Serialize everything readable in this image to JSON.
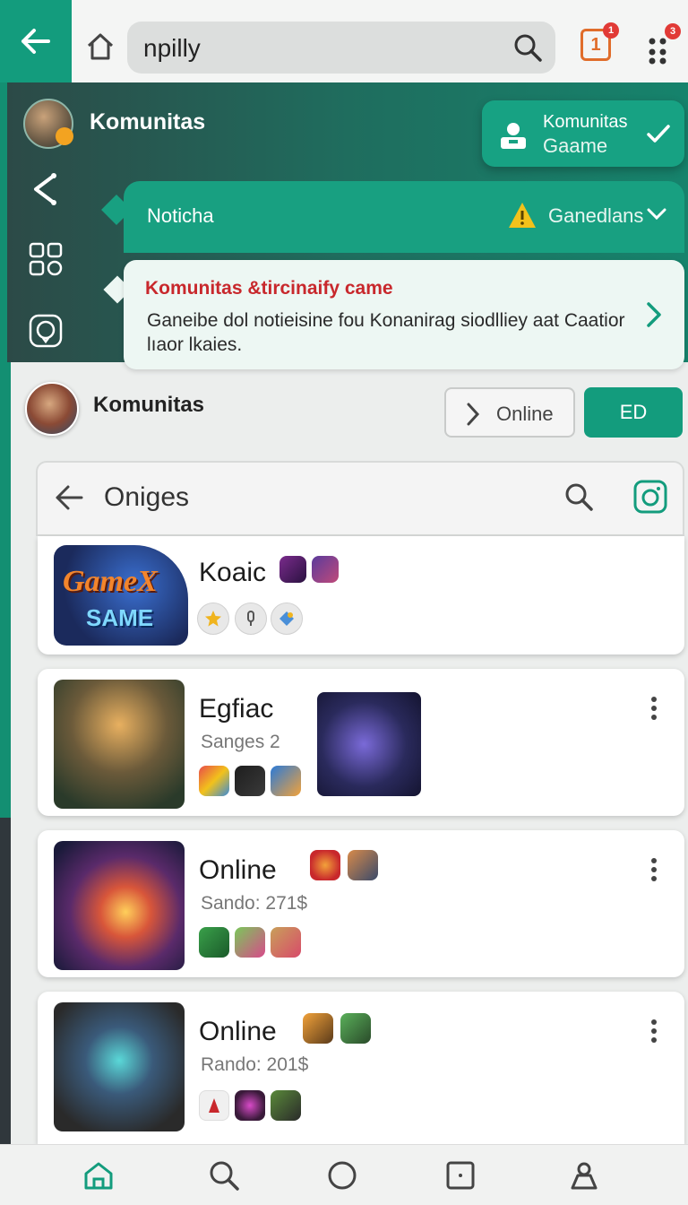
{
  "browser": {
    "url_text": "npilly",
    "tabs_count": "1",
    "tabs_badge": "1",
    "menu_badge": "3"
  },
  "header": {
    "title": "Komunitas",
    "card_line1": "Komunitas",
    "card_line2": "Gaame"
  },
  "notification": {
    "title": "Noticha",
    "right_label": "Ganedlans"
  },
  "message": {
    "title": "Komunitas &tircinaify came",
    "body": "Ganeibe dol notieisine fou Konanirag siodlliey aat Caatior lıaor lkaies."
  },
  "community": {
    "name": "Komunitas",
    "online_label": "Online",
    "ed_label": "ED"
  },
  "panel": {
    "title": "Oniges"
  },
  "games": [
    {
      "name": "Koaic",
      "logo_line1": "GameX",
      "logo_line2": "SAME"
    },
    {
      "name": "Egfiac",
      "sub": "Sanges 2"
    },
    {
      "name": "Online",
      "sub": "Sando: 271$"
    },
    {
      "name": "Online",
      "sub": "Rando: 201$"
    }
  ],
  "colors": {
    "accent": "#139c7d",
    "band_dark": "#2c4a47",
    "warning": "#f2c21b",
    "alert_red": "#c8282c"
  },
  "icons": [
    "back-arrow-icon",
    "home-icon",
    "search-icon",
    "tabs-icon",
    "menu-dots-icon",
    "person-icon",
    "check-icon",
    "share-icon",
    "grid-icon",
    "chat-icon",
    "warning-icon",
    "chevron-right-icon",
    "camera-icon",
    "kebab-icon",
    "nav-home-icon",
    "nav-search-icon",
    "nav-circle-icon",
    "nav-square-icon",
    "nav-profile-icon"
  ]
}
